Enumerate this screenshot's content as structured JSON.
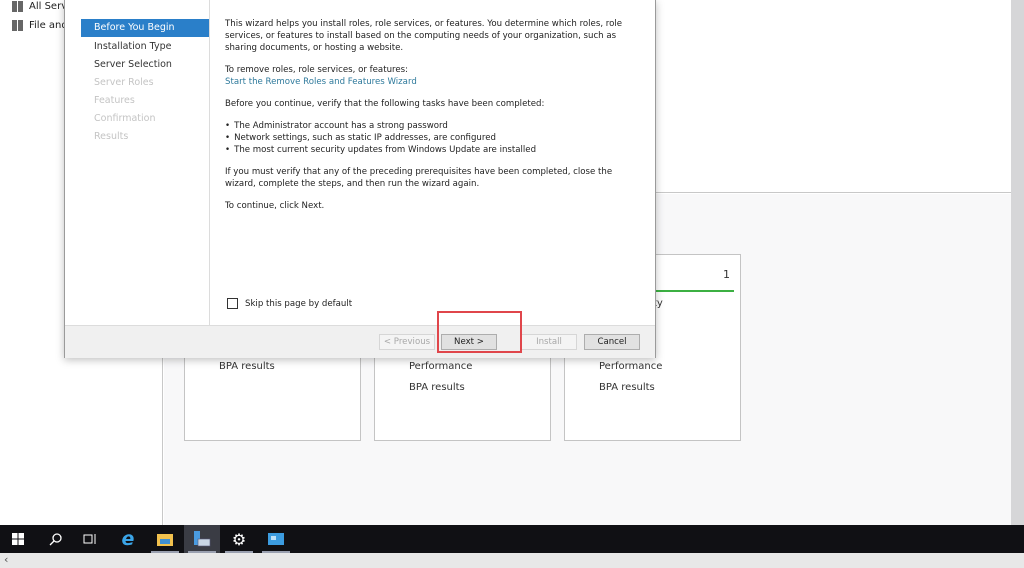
{
  "server_manager": {
    "nav": [
      {
        "label": "All Servers",
        "icon": "servers-icon"
      },
      {
        "label": "File and Storage Services",
        "icon": "file-storage-icon"
      }
    ],
    "cards": [
      {
        "lines": [
          "BPA results"
        ]
      },
      {
        "lines": [
          "Performance",
          "BPA results"
        ]
      },
      {
        "count": "1",
        "status_color": "#3cb043",
        "partial_label": "ty",
        "lines": [
          "Performance",
          "BPA results"
        ]
      }
    ]
  },
  "wizard": {
    "steps": [
      {
        "label": "Before You Begin",
        "state": "selected"
      },
      {
        "label": "Installation Type",
        "state": "enabled"
      },
      {
        "label": "Server Selection",
        "state": "enabled"
      },
      {
        "label": "Server Roles",
        "state": "disabled"
      },
      {
        "label": "Features",
        "state": "disabled"
      },
      {
        "label": "Confirmation",
        "state": "disabled"
      },
      {
        "label": "Results",
        "state": "disabled"
      }
    ],
    "intro": "This wizard helps you install roles, role services, or features. You determine which roles, role services, or features to install based on the computing needs of your organization, such as sharing documents, or hosting a website.",
    "remove_label": "To remove roles, role services, or features:",
    "remove_link": "Start the Remove Roles and Features Wizard",
    "verify_label": "Before you continue, verify that the following tasks have been completed:",
    "tasks": [
      "The Administrator account has a strong password",
      "Network settings, such as static IP addresses, are configured",
      "The most current security updates from Windows Update are installed"
    ],
    "prereq_note": "If you must verify that any of the preceding prerequisites have been completed, close the wizard, complete the steps, and then run the wizard again.",
    "continue_note": "To continue, click Next.",
    "skip_label": "Skip this page by default",
    "skip_checked": false,
    "buttons": {
      "previous": "< Previous",
      "next": "Next >",
      "install": "Install",
      "cancel": "Cancel"
    },
    "highlight_color": "#e0464b",
    "accent": "#2a7fc9"
  },
  "taskbar": {
    "items": [
      "start-icon",
      "search-icon",
      "task-view-icon",
      "internet-explorer-icon",
      "file-explorer-icon",
      "server-manager-icon",
      "settings-icon",
      "remote-desktop-icon"
    ]
  }
}
